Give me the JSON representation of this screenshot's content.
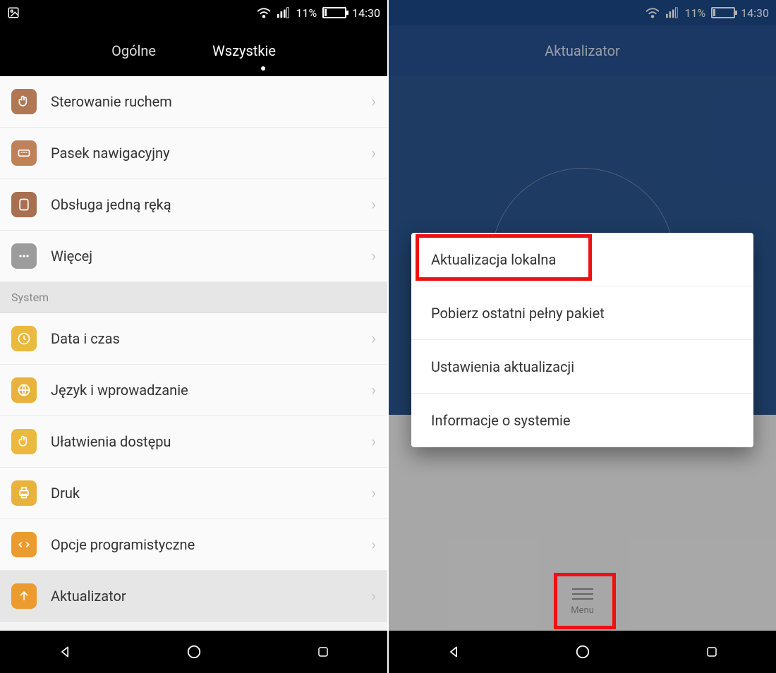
{
  "status": {
    "battery": "11%",
    "time": "14:30"
  },
  "left": {
    "tabs": {
      "general": "Ogólne",
      "all": "Wszystkie"
    },
    "items_top": [
      {
        "label": "Sterowanie ruchem"
      },
      {
        "label": "Pasek nawigacyjny"
      },
      {
        "label": "Obsługa jedną ręką"
      },
      {
        "label": "Więcej"
      }
    ],
    "section": "System",
    "items_sys": [
      {
        "label": "Data i czas"
      },
      {
        "label": "Język i wprowadzanie"
      },
      {
        "label": "Ułatwienia dostępu"
      },
      {
        "label": "Druk"
      },
      {
        "label": "Opcje programistyczne"
      },
      {
        "label": "Aktualizator"
      }
    ]
  },
  "right": {
    "title": "Aktualizator",
    "popup": [
      "Aktualizacja lokalna",
      "Pobierz ostatni pełny pakiet",
      "Ustawienia aktualizacji",
      "Informacje o systemie"
    ],
    "menu_label": "Menu"
  }
}
